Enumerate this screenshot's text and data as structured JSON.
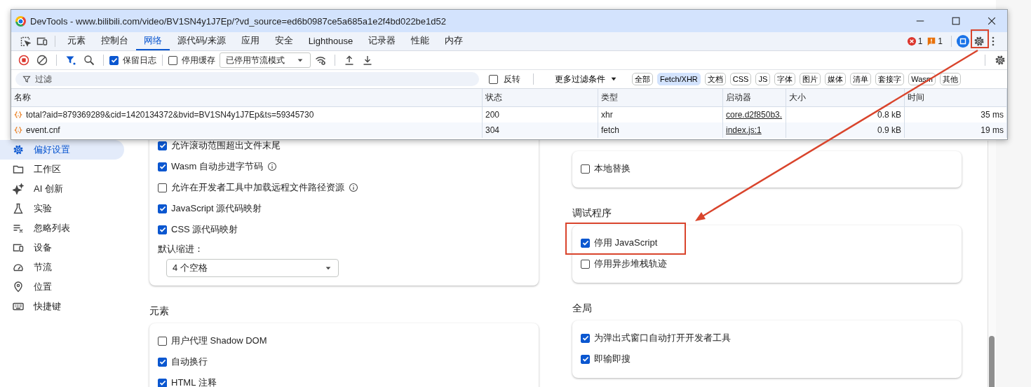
{
  "devtools": {
    "title": "DevTools - www.bilibili.com/video/BV1SN4y1J7Ep/?vd_source=ed6b0987ce5a685a1e2f4bd022be1d52",
    "panel_tabs": [
      {
        "label": "元素",
        "selected": false
      },
      {
        "label": "控制台",
        "selected": false
      },
      {
        "label": "网络",
        "selected": true
      },
      {
        "label": "源代码/来源",
        "selected": false
      },
      {
        "label": "应用",
        "selected": false
      },
      {
        "label": "安全",
        "selected": false
      },
      {
        "label": "Lighthouse",
        "selected": false
      },
      {
        "label": "记录器",
        "selected": false
      },
      {
        "label": "性能",
        "selected": false
      },
      {
        "label": "内存",
        "selected": false
      }
    ],
    "error_count": "1",
    "warning_count": "1",
    "toolbar": {
      "preserve_log": {
        "label": "保留日志",
        "checked": true
      },
      "disable_cache": {
        "label": "停用缓存",
        "checked": false
      },
      "throttling": "已停用节流模式"
    },
    "filter": {
      "placeholder": "过滤",
      "invert": {
        "label": "反转",
        "checked": false
      },
      "more_filters": "更多过滤条件",
      "type_chips": [
        {
          "label": "全部",
          "selected": false
        },
        {
          "label": "Fetch/XHR",
          "selected": true
        },
        {
          "label": "文档",
          "selected": false
        },
        {
          "label": "CSS",
          "selected": false
        },
        {
          "label": "JS",
          "selected": false
        },
        {
          "label": "字体",
          "selected": false
        },
        {
          "label": "图片",
          "selected": false
        },
        {
          "label": "媒体",
          "selected": false
        },
        {
          "label": "清单",
          "selected": false
        },
        {
          "label": "套接字",
          "selected": false
        },
        {
          "label": "Wasm",
          "selected": false
        },
        {
          "label": "其他",
          "selected": false
        }
      ]
    },
    "table": {
      "columns": [
        "名称",
        "状态",
        "类型",
        "启动器",
        "大小",
        "时间"
      ],
      "rows": [
        {
          "name": "total?aid=879369289&cid=1420134372&bvid=BV1SN4y1J7Ep&ts=59345730",
          "status": "200",
          "type": "xhr",
          "initiator": "core.d2f850b3.",
          "size": "0.8 kB",
          "time": "35 ms"
        },
        {
          "name": "event.cnf",
          "status": "304",
          "type": "fetch",
          "initiator": "index.js:1",
          "size": "0.9 kB",
          "time": "19 ms"
        }
      ]
    }
  },
  "settings": {
    "sidebar": [
      {
        "label": "偏好设置",
        "selected": true
      },
      {
        "label": "工作区",
        "selected": false
      },
      {
        "label": "AI 创新",
        "selected": false
      },
      {
        "label": "实验",
        "selected": false
      },
      {
        "label": "忽略列表",
        "selected": false
      },
      {
        "label": "设备",
        "selected": false
      },
      {
        "label": "节流",
        "selected": false
      },
      {
        "label": "位置",
        "selected": false
      },
      {
        "label": "快捷键",
        "selected": false
      }
    ],
    "columns": [
      {
        "sections": [
          {
            "items": [
              {
                "kind": "checkbox",
                "label": "允许滚动范围超出文件末尾",
                "checked": true,
                "info": false
              },
              {
                "kind": "checkbox",
                "label": "Wasm 自动步进字节码",
                "checked": true,
                "info": true
              },
              {
                "kind": "checkbox",
                "label": "允许在开发者工具中加载远程文件路径资源",
                "checked": false,
                "info": true
              },
              {
                "kind": "checkbox",
                "label": "JavaScript 源代码映射",
                "checked": true,
                "info": false
              },
              {
                "kind": "checkbox",
                "label": "CSS 源代码映射",
                "checked": true,
                "info": false
              },
              {
                "kind": "select",
                "label": "默认缩进：",
                "value": "4 个空格"
              }
            ]
          },
          {
            "heading": "元素",
            "items": [
              {
                "kind": "checkbox",
                "label": "用户代理 Shadow DOM",
                "checked": false,
                "info": false
              },
              {
                "kind": "checkbox",
                "label": "自动换行",
                "checked": true,
                "info": false
              },
              {
                "kind": "checkbox",
                "label": "HTML 注释",
                "checked": true,
                "info": false
              }
            ]
          }
        ]
      },
      {
        "sections": [
          {
            "items": [
              {
                "kind": "checkbox",
                "label": "本地替换",
                "checked": false,
                "info": false
              }
            ]
          },
          {
            "heading": "调试程序",
            "items": [
              {
                "kind": "checkbox",
                "label": "停用 JavaScript",
                "checked": true,
                "info": false
              },
              {
                "kind": "checkbox",
                "label": "停用异步堆栈轨迹",
                "checked": false,
                "info": false
              }
            ]
          },
          {
            "heading": "全局",
            "items": [
              {
                "kind": "checkbox",
                "label": "为弹出式窗口自动打开开发者工具",
                "checked": true,
                "info": false
              },
              {
                "kind": "checkbox",
                "label": "即输即搜",
                "checked": true,
                "info": false
              }
            ]
          }
        ]
      }
    ]
  }
}
